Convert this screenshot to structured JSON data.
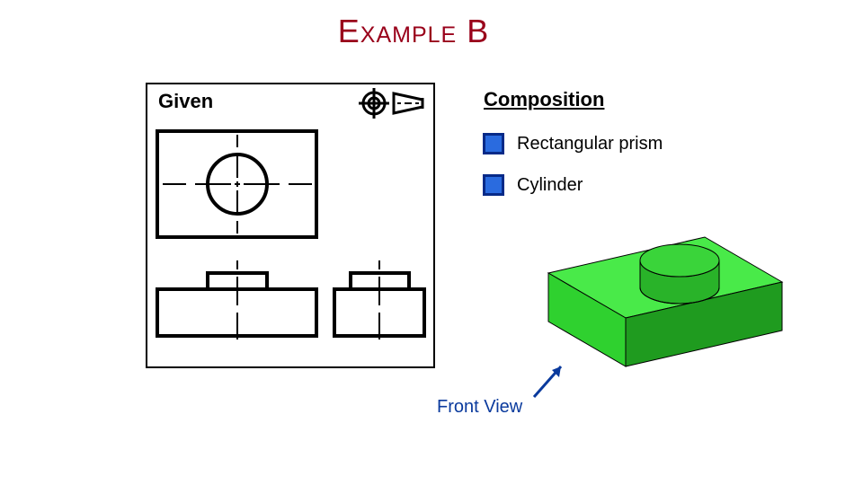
{
  "title": "Example B",
  "given_label": "Given",
  "composition_label": "Composition",
  "legend": {
    "rect": "Rectangular prism",
    "cyl": "Cylinder"
  },
  "front_view_label": "Front View",
  "icons": {
    "orienter": "orientation-crosshair-icon",
    "cone": "cone-projection-icon",
    "crosshair": "crosshair-center-icon",
    "bullet": "square-bullet-icon"
  },
  "colors": {
    "prism_face": "#2fd12f",
    "prism_top": "#49ea49",
    "prism_side": "#1f9b1f",
    "cyl_top": "#3ad43a",
    "cyl_side": "#29b329",
    "outline": "#0a3a9d",
    "title": "#99001a"
  }
}
